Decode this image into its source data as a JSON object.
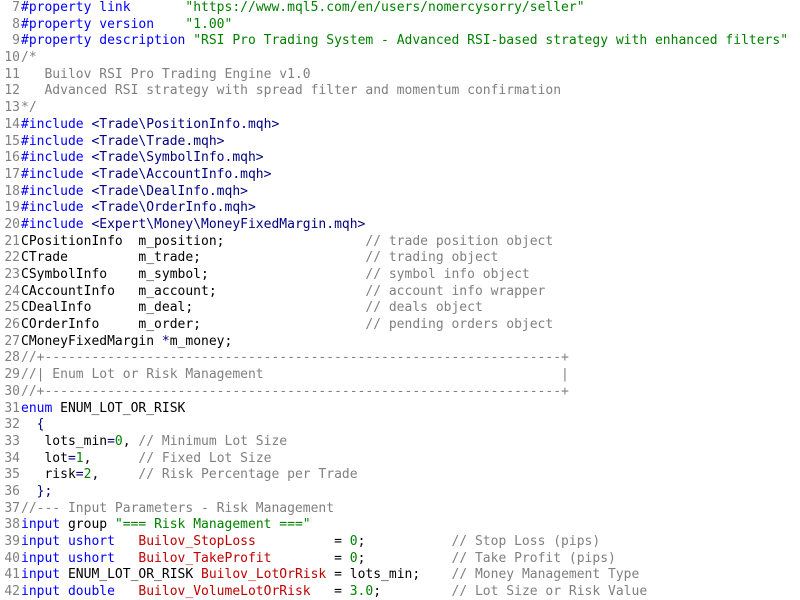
{
  "editor": {
    "lines": [
      {
        "n": "7",
        "tokens": [
          {
            "t": "#property",
            "c": "pp"
          },
          {
            "t": " link       ",
            "c": "kw"
          },
          {
            "t": "\"https://www.mql5.com/en/users/nomercysorry/seller\"",
            "c": "str"
          }
        ]
      },
      {
        "n": "8",
        "tokens": [
          {
            "t": "#property",
            "c": "pp"
          },
          {
            "t": " version    ",
            "c": "kw"
          },
          {
            "t": "\"1.00\"",
            "c": "str"
          }
        ]
      },
      {
        "n": "9",
        "tokens": [
          {
            "t": "#property",
            "c": "pp"
          },
          {
            "t": " description ",
            "c": "kw"
          },
          {
            "t": "\"RSI Pro Trading System - Advanced RSI-based strategy with enhanced filters\"",
            "c": "str"
          }
        ]
      },
      {
        "n": "10",
        "tokens": [
          {
            "t": "/*",
            "c": "cmt"
          }
        ]
      },
      {
        "n": "11",
        "tokens": [
          {
            "t": "   Builov RSI Pro Trading Engine v1.0",
            "c": "cmt"
          }
        ]
      },
      {
        "n": "12",
        "tokens": [
          {
            "t": "   Advanced RSI strategy with spread filter and momentum confirmation",
            "c": "cmt"
          }
        ]
      },
      {
        "n": "13",
        "tokens": [
          {
            "t": "*/",
            "c": "cmt"
          }
        ]
      },
      {
        "n": "14",
        "tokens": [
          {
            "t": "#include",
            "c": "pp"
          },
          {
            "t": " <Trade\\PositionInfo.mqh>",
            "c": "ang"
          }
        ]
      },
      {
        "n": "15",
        "tokens": [
          {
            "t": "#include",
            "c": "pp"
          },
          {
            "t": " <Trade\\Trade.mqh>",
            "c": "ang"
          }
        ]
      },
      {
        "n": "16",
        "tokens": [
          {
            "t": "#include",
            "c": "pp"
          },
          {
            "t": " <Trade\\SymbolInfo.mqh>",
            "c": "ang"
          }
        ]
      },
      {
        "n": "17",
        "tokens": [
          {
            "t": "#include",
            "c": "pp"
          },
          {
            "t": " <Trade\\AccountInfo.mqh>",
            "c": "ang"
          }
        ]
      },
      {
        "n": "18",
        "tokens": [
          {
            "t": "#include",
            "c": "pp"
          },
          {
            "t": " <Trade\\DealInfo.mqh>",
            "c": "ang"
          }
        ]
      },
      {
        "n": "19",
        "tokens": [
          {
            "t": "#include",
            "c": "pp"
          },
          {
            "t": " <Trade\\OrderInfo.mqh>",
            "c": "ang"
          }
        ]
      },
      {
        "n": "20",
        "tokens": [
          {
            "t": "#include",
            "c": "pp"
          },
          {
            "t": " <Expert\\Money\\MoneyFixedMargin.mqh>",
            "c": "ang"
          }
        ]
      },
      {
        "n": "21",
        "tokens": [
          {
            "t": "CPositionInfo  m_position;                  ",
            "c": "pl"
          },
          {
            "t": "// trade position object",
            "c": "cmt"
          }
        ]
      },
      {
        "n": "22",
        "tokens": [
          {
            "t": "CTrade         m_trade;                     ",
            "c": "pl"
          },
          {
            "t": "// trading object",
            "c": "cmt"
          }
        ]
      },
      {
        "n": "23",
        "tokens": [
          {
            "t": "CSymbolInfo    m_symbol;                    ",
            "c": "pl"
          },
          {
            "t": "// symbol info object",
            "c": "cmt"
          }
        ]
      },
      {
        "n": "24",
        "tokens": [
          {
            "t": "CAccountInfo   m_account;                   ",
            "c": "pl"
          },
          {
            "t": "// account info wrapper",
            "c": "cmt"
          }
        ]
      },
      {
        "n": "25",
        "tokens": [
          {
            "t": "CDealInfo      m_deal;                      ",
            "c": "pl"
          },
          {
            "t": "// deals object",
            "c": "cmt"
          }
        ]
      },
      {
        "n": "26",
        "tokens": [
          {
            "t": "COrderInfo     m_order;                     ",
            "c": "pl"
          },
          {
            "t": "// pending orders object",
            "c": "cmt"
          }
        ]
      },
      {
        "n": "27",
        "tokens": [
          {
            "t": "CMoneyFixedMargin ",
            "c": "pl"
          },
          {
            "t": "*",
            "c": "op"
          },
          {
            "t": "m_money;",
            "c": "pl"
          }
        ]
      },
      {
        "n": "28",
        "tokens": [
          {
            "t": "//+------------------------------------------------------------------+",
            "c": "cmt"
          }
        ]
      },
      {
        "n": "29",
        "tokens": [
          {
            "t": "//| Enum Lot or Risk Management                                      |",
            "c": "cmt"
          }
        ]
      },
      {
        "n": "30",
        "tokens": [
          {
            "t": "//+------------------------------------------------------------------+",
            "c": "cmt"
          }
        ]
      },
      {
        "n": "31",
        "tokens": [
          {
            "t": "enum",
            "c": "kw"
          },
          {
            "t": " ENUM_LOT_OR_RISK",
            "c": "pl"
          }
        ]
      },
      {
        "n": "32",
        "tokens": [
          {
            "t": "  {",
            "c": "op"
          }
        ]
      },
      {
        "n": "33",
        "tokens": [
          {
            "t": "   lots_min",
            "c": "pl"
          },
          {
            "t": "=",
            "c": "op"
          },
          {
            "t": "0",
            "c": "num"
          },
          {
            "t": ", ",
            "c": "pl"
          },
          {
            "t": "// Minimum Lot Size",
            "c": "cmt"
          }
        ]
      },
      {
        "n": "34",
        "tokens": [
          {
            "t": "   lot",
            "c": "pl"
          },
          {
            "t": "=",
            "c": "op"
          },
          {
            "t": "1",
            "c": "num"
          },
          {
            "t": ",      ",
            "c": "pl"
          },
          {
            "t": "// Fixed Lot Size",
            "c": "cmt"
          }
        ]
      },
      {
        "n": "35",
        "tokens": [
          {
            "t": "   risk",
            "c": "pl"
          },
          {
            "t": "=",
            "c": "op"
          },
          {
            "t": "2",
            "c": "num"
          },
          {
            "t": ",     ",
            "c": "pl"
          },
          {
            "t": "// Risk Percentage per Trade",
            "c": "cmt"
          }
        ]
      },
      {
        "n": "36",
        "tokens": [
          {
            "t": "  };",
            "c": "op"
          }
        ]
      },
      {
        "n": "37",
        "tokens": [
          {
            "t": "//--- Input Parameters - Risk Management",
            "c": "cmt"
          }
        ]
      },
      {
        "n": "38",
        "tokens": [
          {
            "t": "input",
            "c": "kw"
          },
          {
            "t": " group ",
            "c": "pl"
          },
          {
            "t": "\"=== Risk Management ===\"",
            "c": "str"
          }
        ]
      },
      {
        "n": "39",
        "tokens": [
          {
            "t": "input ushort",
            "c": "kw"
          },
          {
            "t": "   ",
            "c": "pl"
          },
          {
            "t": "Builov_StopLoss",
            "c": "var"
          },
          {
            "t": "          = ",
            "c": "pl"
          },
          {
            "t": "0",
            "c": "num"
          },
          {
            "t": ";           ",
            "c": "pl"
          },
          {
            "t": "// Stop Loss (pips)",
            "c": "cmt"
          }
        ]
      },
      {
        "n": "40",
        "tokens": [
          {
            "t": "input ushort",
            "c": "kw"
          },
          {
            "t": "   ",
            "c": "pl"
          },
          {
            "t": "Builov_TakeProfit",
            "c": "var"
          },
          {
            "t": "        = ",
            "c": "pl"
          },
          {
            "t": "0",
            "c": "num"
          },
          {
            "t": ";           ",
            "c": "pl"
          },
          {
            "t": "// Take Profit (pips)",
            "c": "cmt"
          }
        ]
      },
      {
        "n": "41",
        "tokens": [
          {
            "t": "input",
            "c": "kw"
          },
          {
            "t": " ENUM_LOT_OR_RISK ",
            "c": "pl"
          },
          {
            "t": "Builov_LotOrRisk",
            "c": "var"
          },
          {
            "t": " = lots_min;    ",
            "c": "pl"
          },
          {
            "t": "// Money Management Type",
            "c": "cmt"
          }
        ]
      },
      {
        "n": "42",
        "tokens": [
          {
            "t": "input double",
            "c": "kw"
          },
          {
            "t": "   ",
            "c": "pl"
          },
          {
            "t": "Builov_VolumeLotOrRisk",
            "c": "var"
          },
          {
            "t": "   = ",
            "c": "pl"
          },
          {
            "t": "3.0",
            "c": "num"
          },
          {
            "t": ";         ",
            "c": "pl"
          },
          {
            "t": "// Lot Size or Risk Value",
            "c": "cmt"
          }
        ]
      }
    ]
  }
}
